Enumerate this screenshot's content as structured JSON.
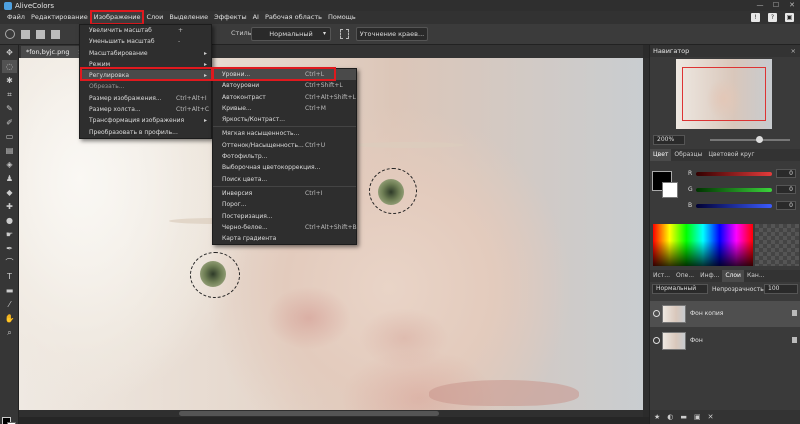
{
  "app": {
    "title": "AliveColors",
    "window_controls": [
      "—",
      "☐",
      "✕"
    ]
  },
  "menubar": {
    "items": [
      "Файл",
      "Редактирование",
      "Изображение",
      "Слои",
      "Выделение",
      "Эффекты",
      "AI",
      "Рабочая область",
      "Помощь"
    ],
    "active": "Изображение",
    "right_icons": [
      "!",
      "?",
      "▣"
    ]
  },
  "options": {
    "style_label": "Стиль:",
    "style_value": "Нормальный",
    "refine_button": "Уточнение краев..."
  },
  "tools": [
    "selection-tool",
    "lasso-tool",
    "crop-tool",
    "eyedropper-tool",
    "brush-tool",
    "eraser-tool",
    "gradient-tool",
    "stamp-tool",
    "heal-tool",
    "blur-tool",
    "dodge-tool",
    "pen-tool",
    "text-tool",
    "shape-tool",
    "hand-tool",
    "zoom-tool"
  ],
  "document": {
    "tab_title": "*fon,byjc.png",
    "tab_close": "×"
  },
  "image_menu": {
    "items": [
      {
        "label": "Увеличить масштаб",
        "shortcut": "+",
        "disabled": false
      },
      {
        "label": "Уменьшить масштаб",
        "shortcut": "-",
        "disabled": false
      },
      {
        "label": "Масштабирование",
        "arrow": "▸"
      },
      {
        "label": "Режим",
        "arrow": "▸"
      },
      {
        "label": "Регулировка",
        "arrow": "▸",
        "highlighted": true
      },
      {
        "label": "Обрезать...",
        "disabled": true
      },
      {
        "label": "Размер изображения...",
        "shortcut": "Ctrl+Alt+I"
      },
      {
        "label": "Размер холста...",
        "shortcut": "Ctrl+Alt+C"
      },
      {
        "label": "Трансформация изображения",
        "arrow": "▸"
      },
      {
        "label": "Преобразовать в профиль..."
      }
    ]
  },
  "adjust_menu": {
    "items": [
      {
        "label": "Уровни...",
        "shortcut": "Ctrl+L",
        "highlighted": true
      },
      {
        "label": "Автоуровни",
        "shortcut": "Ctrl+Shift+L"
      },
      {
        "label": "Автоконтраст",
        "shortcut": "Ctrl+Alt+Shift+L"
      },
      {
        "label": "Кривые...",
        "shortcut": "Ctrl+M"
      },
      {
        "label": "Яркость/Контраст..."
      },
      {
        "label": "Мягкая насыщенность..."
      },
      {
        "label": "Оттенок/Насыщенность...",
        "shortcut": "Ctrl+U"
      },
      {
        "label": "Фотофильтр..."
      },
      {
        "label": "Выборочная цветокоррекция..."
      },
      {
        "label": "Поиск цвета..."
      },
      {
        "label": "Инверсия",
        "shortcut": "Ctrl+I"
      },
      {
        "label": "Порог..."
      },
      {
        "label": "Постеризация..."
      },
      {
        "label": "Черно-белое...",
        "shortcut": "Ctrl+Alt+Shift+B"
      },
      {
        "label": "Карта градиента"
      }
    ]
  },
  "navigator": {
    "title": "Навигатор",
    "zoom": "200%"
  },
  "color_panel": {
    "tabs": [
      "Цвет",
      "Образцы",
      "Цветовой круг"
    ],
    "active_tab": "Цвет",
    "sliders": [
      {
        "label": "R",
        "value": "0",
        "color": "#e43b3b"
      },
      {
        "label": "G",
        "value": "0",
        "color": "#3bd43b"
      },
      {
        "label": "B",
        "value": "0",
        "color": "#3b5bff"
      }
    ]
  },
  "layers_panel": {
    "tabs": [
      "Ист...",
      "Опе...",
      "Инф...",
      "Слои",
      "Кан..."
    ],
    "active_tab": "Слои",
    "blend_mode": "Нормальный",
    "opacity_label": "Непрозрачность",
    "opacity_value": "100",
    "layers": [
      {
        "name": "Фон копия",
        "selected": true
      },
      {
        "name": "Фон",
        "selected": false
      }
    ]
  },
  "colors": {
    "accent_red": "#e0191e",
    "panel_bg": "#3a3a3a",
    "menu_bg": "#2e2e2e"
  }
}
